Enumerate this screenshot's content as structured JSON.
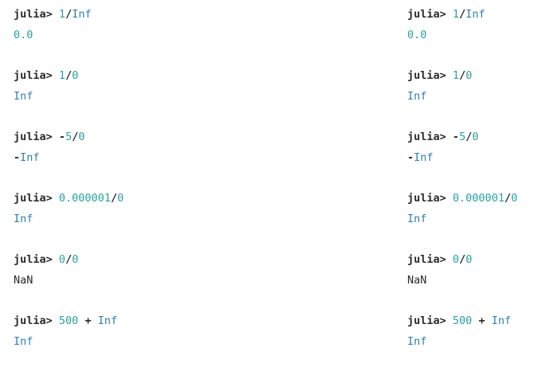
{
  "prompt": "julia>",
  "colors": {
    "prompt": "#2b2b2b",
    "number": "#2aa1a1",
    "keyword": "#2e7fb8",
    "operator": "#2b2b2b"
  },
  "columns": [
    {
      "entries": [
        {
          "input": [
            {
              "t": "1",
              "k": "num"
            },
            {
              "t": "/",
              "k": "op"
            },
            {
              "t": "Inf",
              "k": "kw"
            }
          ],
          "output": [
            {
              "t": "0.0",
              "k": "num"
            }
          ]
        },
        {
          "input": [
            {
              "t": "1",
              "k": "num"
            },
            {
              "t": "/",
              "k": "op"
            },
            {
              "t": "0",
              "k": "num"
            }
          ],
          "output": [
            {
              "t": "Inf",
              "k": "kw"
            }
          ]
        },
        {
          "input": [
            {
              "t": "-",
              "k": "op"
            },
            {
              "t": "5",
              "k": "num"
            },
            {
              "t": "/",
              "k": "op"
            },
            {
              "t": "0",
              "k": "num"
            }
          ],
          "output": [
            {
              "t": "-",
              "k": "op"
            },
            {
              "t": "Inf",
              "k": "kw"
            }
          ]
        },
        {
          "input": [
            {
              "t": "0.000001",
              "k": "num"
            },
            {
              "t": "/",
              "k": "op"
            },
            {
              "t": "0",
              "k": "num"
            }
          ],
          "output": [
            {
              "t": "Inf",
              "k": "kw"
            }
          ]
        },
        {
          "input": [
            {
              "t": "0",
              "k": "num"
            },
            {
              "t": "/",
              "k": "op"
            },
            {
              "t": "0",
              "k": "num"
            }
          ],
          "output": [
            {
              "t": "NaN",
              "k": "plain"
            }
          ]
        },
        {
          "input": [
            {
              "t": "500",
              "k": "num"
            },
            {
              "t": " + ",
              "k": "op"
            },
            {
              "t": "Inf",
              "k": "kw"
            }
          ],
          "output": [
            {
              "t": "Inf",
              "k": "kw"
            }
          ]
        }
      ]
    },
    {
      "entries": [
        {
          "input": [
            {
              "t": "1",
              "k": "num"
            },
            {
              "t": "/",
              "k": "op"
            },
            {
              "t": "Inf",
              "k": "kw"
            }
          ],
          "output": [
            {
              "t": "0.0",
              "k": "num"
            }
          ]
        },
        {
          "input": [
            {
              "t": "1",
              "k": "num"
            },
            {
              "t": "/",
              "k": "op"
            },
            {
              "t": "0",
              "k": "num"
            }
          ],
          "output": [
            {
              "t": "Inf",
              "k": "kw"
            }
          ]
        },
        {
          "input": [
            {
              "t": "-",
              "k": "op"
            },
            {
              "t": "5",
              "k": "num"
            },
            {
              "t": "/",
              "k": "op"
            },
            {
              "t": "0",
              "k": "num"
            }
          ],
          "output": [
            {
              "t": "-",
              "k": "op"
            },
            {
              "t": "Inf",
              "k": "kw"
            }
          ]
        },
        {
          "input": [
            {
              "t": "0.000001",
              "k": "num"
            },
            {
              "t": "/",
              "k": "op"
            },
            {
              "t": "0",
              "k": "num"
            }
          ],
          "output": [
            {
              "t": "Inf",
              "k": "kw"
            }
          ]
        },
        {
          "input": [
            {
              "t": "0",
              "k": "num"
            },
            {
              "t": "/",
              "k": "op"
            },
            {
              "t": "0",
              "k": "num"
            }
          ],
          "output": [
            {
              "t": "NaN",
              "k": "plain"
            }
          ]
        },
        {
          "input": [
            {
              "t": "500",
              "k": "num"
            },
            {
              "t": " + ",
              "k": "op"
            },
            {
              "t": "Inf",
              "k": "kw"
            }
          ],
          "output": [
            {
              "t": "Inf",
              "k": "kw"
            }
          ]
        }
      ]
    }
  ]
}
